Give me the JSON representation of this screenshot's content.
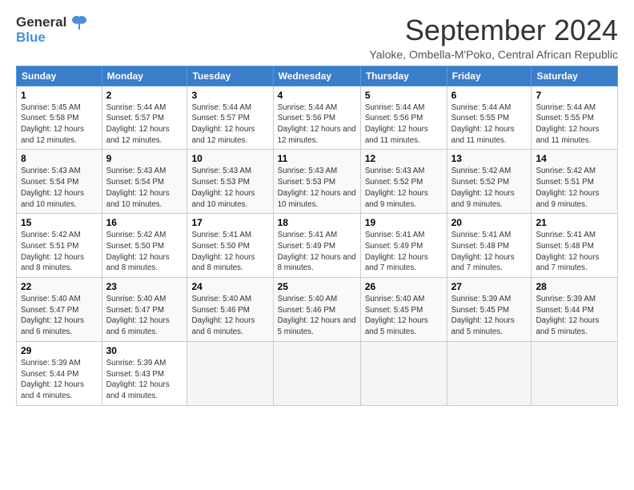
{
  "logo": {
    "line1": "General",
    "line2": "Blue"
  },
  "title": "September 2024",
  "subtitle": "Yaloke, Ombella-M'Poko, Central African Republic",
  "days_of_week": [
    "Sunday",
    "Monday",
    "Tuesday",
    "Wednesday",
    "Thursday",
    "Friday",
    "Saturday"
  ],
  "weeks": [
    [
      {
        "day": "1",
        "sunrise": "5:45 AM",
        "sunset": "5:58 PM",
        "daylight": "12 hours and 12 minutes."
      },
      {
        "day": "2",
        "sunrise": "5:44 AM",
        "sunset": "5:57 PM",
        "daylight": "12 hours and 12 minutes."
      },
      {
        "day": "3",
        "sunrise": "5:44 AM",
        "sunset": "5:57 PM",
        "daylight": "12 hours and 12 minutes."
      },
      {
        "day": "4",
        "sunrise": "5:44 AM",
        "sunset": "5:56 PM",
        "daylight": "12 hours and 12 minutes."
      },
      {
        "day": "5",
        "sunrise": "5:44 AM",
        "sunset": "5:56 PM",
        "daylight": "12 hours and 11 minutes."
      },
      {
        "day": "6",
        "sunrise": "5:44 AM",
        "sunset": "5:55 PM",
        "daylight": "12 hours and 11 minutes."
      },
      {
        "day": "7",
        "sunrise": "5:44 AM",
        "sunset": "5:55 PM",
        "daylight": "12 hours and 11 minutes."
      }
    ],
    [
      {
        "day": "8",
        "sunrise": "5:43 AM",
        "sunset": "5:54 PM",
        "daylight": "12 hours and 10 minutes."
      },
      {
        "day": "9",
        "sunrise": "5:43 AM",
        "sunset": "5:54 PM",
        "daylight": "12 hours and 10 minutes."
      },
      {
        "day": "10",
        "sunrise": "5:43 AM",
        "sunset": "5:53 PM",
        "daylight": "12 hours and 10 minutes."
      },
      {
        "day": "11",
        "sunrise": "5:43 AM",
        "sunset": "5:53 PM",
        "daylight": "12 hours and 10 minutes."
      },
      {
        "day": "12",
        "sunrise": "5:43 AM",
        "sunset": "5:52 PM",
        "daylight": "12 hours and 9 minutes."
      },
      {
        "day": "13",
        "sunrise": "5:42 AM",
        "sunset": "5:52 PM",
        "daylight": "12 hours and 9 minutes."
      },
      {
        "day": "14",
        "sunrise": "5:42 AM",
        "sunset": "5:51 PM",
        "daylight": "12 hours and 9 minutes."
      }
    ],
    [
      {
        "day": "15",
        "sunrise": "5:42 AM",
        "sunset": "5:51 PM",
        "daylight": "12 hours and 8 minutes."
      },
      {
        "day": "16",
        "sunrise": "5:42 AM",
        "sunset": "5:50 PM",
        "daylight": "12 hours and 8 minutes."
      },
      {
        "day": "17",
        "sunrise": "5:41 AM",
        "sunset": "5:50 PM",
        "daylight": "12 hours and 8 minutes."
      },
      {
        "day": "18",
        "sunrise": "5:41 AM",
        "sunset": "5:49 PM",
        "daylight": "12 hours and 8 minutes."
      },
      {
        "day": "19",
        "sunrise": "5:41 AM",
        "sunset": "5:49 PM",
        "daylight": "12 hours and 7 minutes."
      },
      {
        "day": "20",
        "sunrise": "5:41 AM",
        "sunset": "5:48 PM",
        "daylight": "12 hours and 7 minutes."
      },
      {
        "day": "21",
        "sunrise": "5:41 AM",
        "sunset": "5:48 PM",
        "daylight": "12 hours and 7 minutes."
      }
    ],
    [
      {
        "day": "22",
        "sunrise": "5:40 AM",
        "sunset": "5:47 PM",
        "daylight": "12 hours and 6 minutes."
      },
      {
        "day": "23",
        "sunrise": "5:40 AM",
        "sunset": "5:47 PM",
        "daylight": "12 hours and 6 minutes."
      },
      {
        "day": "24",
        "sunrise": "5:40 AM",
        "sunset": "5:46 PM",
        "daylight": "12 hours and 6 minutes."
      },
      {
        "day": "25",
        "sunrise": "5:40 AM",
        "sunset": "5:46 PM",
        "daylight": "12 hours and 5 minutes."
      },
      {
        "day": "26",
        "sunrise": "5:40 AM",
        "sunset": "5:45 PM",
        "daylight": "12 hours and 5 minutes."
      },
      {
        "day": "27",
        "sunrise": "5:39 AM",
        "sunset": "5:45 PM",
        "daylight": "12 hours and 5 minutes."
      },
      {
        "day": "28",
        "sunrise": "5:39 AM",
        "sunset": "5:44 PM",
        "daylight": "12 hours and 5 minutes."
      }
    ],
    [
      {
        "day": "29",
        "sunrise": "5:39 AM",
        "sunset": "5:44 PM",
        "daylight": "12 hours and 4 minutes."
      },
      {
        "day": "30",
        "sunrise": "5:39 AM",
        "sunset": "5:43 PM",
        "daylight": "12 hours and 4 minutes."
      },
      null,
      null,
      null,
      null,
      null
    ]
  ]
}
